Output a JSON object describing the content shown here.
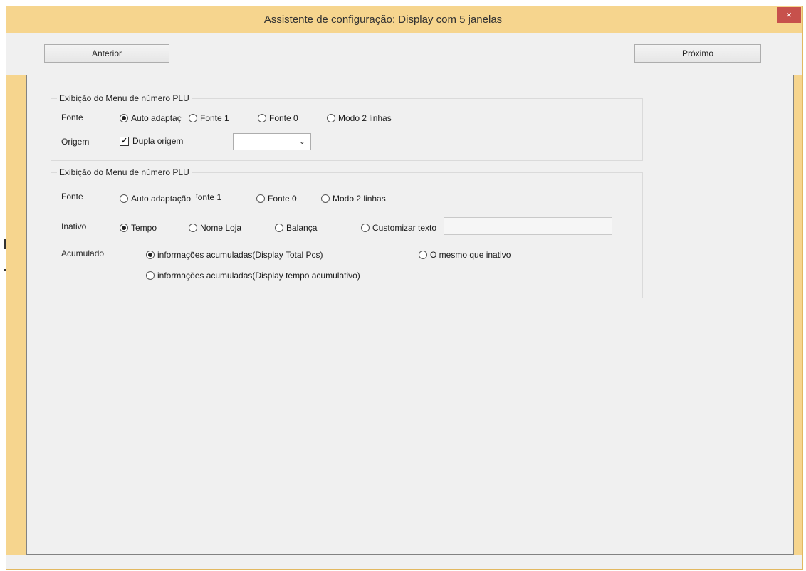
{
  "window": {
    "title": "Assistente de configuração: Display com 5 janelas",
    "close_label": "×"
  },
  "nav": {
    "prev_label": "Anterior",
    "next_label": "Próximo"
  },
  "group1": {
    "title": "Exibição do Menu de número PLU",
    "fonte_label": "Fonte",
    "fonte_options": [
      {
        "label": "Auto adaptaç",
        "selected": true
      },
      {
        "label": "Fonte 1",
        "selected": false
      },
      {
        "label": "Fonte 0",
        "selected": false
      },
      {
        "label": "Modo 2 linhas",
        "selected": false
      }
    ],
    "origem_label": "Origem",
    "dupla_origem_label": "Dupla origem",
    "dupla_origem_checked": true,
    "origem_select_value": "",
    "chevron_glyph": "⌄"
  },
  "group2": {
    "title": "Exibição do Menu de número PLU",
    "fonte_label": "Fonte",
    "fonte_options": [
      {
        "label": "Auto adaptação",
        "selected": false
      },
      {
        "label": "ᶠonte 1",
        "selected": false
      },
      {
        "label": "Fonte 0",
        "selected": false
      },
      {
        "label": "Modo 2 linhas",
        "selected": false
      }
    ],
    "inativo_label": "Inativo",
    "inativo_options": [
      {
        "label": "Tempo",
        "selected": true
      },
      {
        "label": "Nome Loja",
        "selected": false
      },
      {
        "label": "Balança",
        "selected": false
      },
      {
        "label": "Customizar texto",
        "selected": false
      }
    ],
    "custom_text_value": "",
    "acumulado_label": "Acumulado",
    "acumulado_options": [
      {
        "label": "informações acumuladas(Display Total Pcs)",
        "selected": true
      },
      {
        "label": "O mesmo que inativo",
        "selected": false
      },
      {
        "label": "informações acumuladas(Display tempo acumulativo)",
        "selected": false
      }
    ]
  },
  "colors": {
    "window_frame": "#f6d58e",
    "close_button": "#c7514c",
    "client_bg": "#f0f0f0"
  }
}
